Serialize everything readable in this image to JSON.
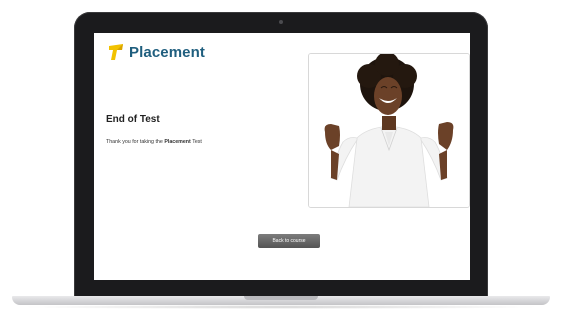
{
  "brand": {
    "logo_icon": "placement-flag-icon",
    "name": "Placement",
    "colors": {
      "brand_text": "#1f5e7e",
      "mark_yellow": "#f2c200"
    }
  },
  "content": {
    "title": "End of Test",
    "message_prefix": "Thank you for taking the ",
    "message_brand": "Placement",
    "message_suffix": " Test"
  },
  "illustration": {
    "description_icon": "celebrating-person-photo"
  },
  "actions": {
    "back_label": "Back to course"
  }
}
